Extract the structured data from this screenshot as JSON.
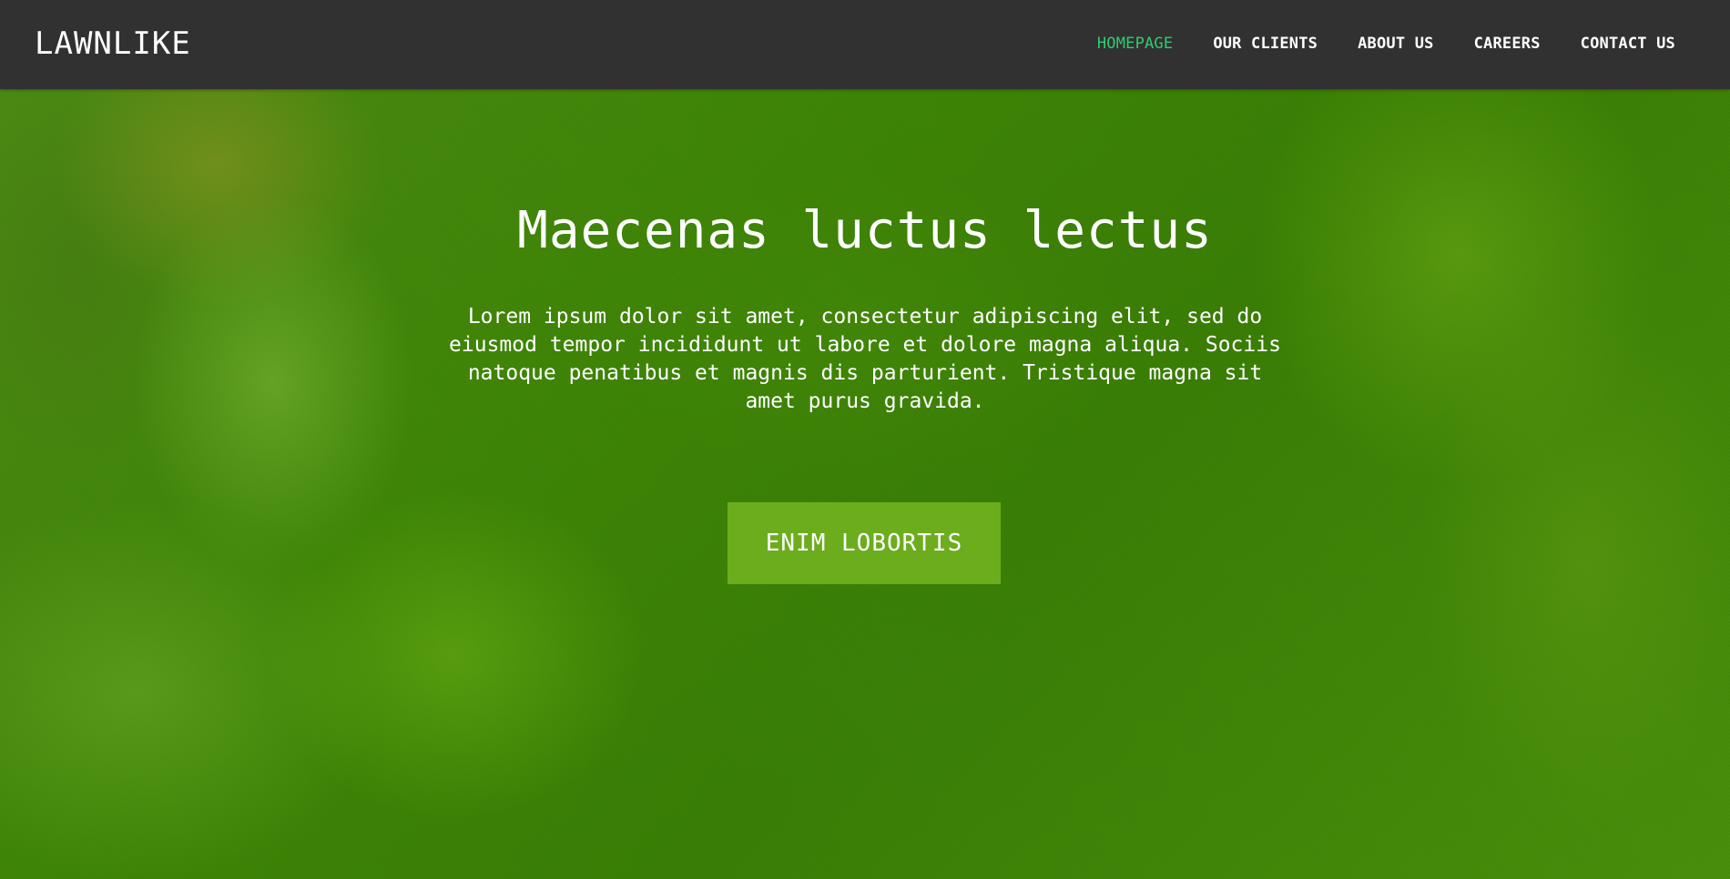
{
  "header": {
    "brand": "LAWNLIKE",
    "nav": [
      {
        "label": "HOMEPAGE",
        "active": true
      },
      {
        "label": "OUR CLIENTS",
        "active": false
      },
      {
        "label": "ABOUT US",
        "active": false
      },
      {
        "label": "CAREERS",
        "active": false
      },
      {
        "label": "CONTACT US",
        "active": false
      }
    ]
  },
  "hero": {
    "title": "Maecenas luctus lectus",
    "text": "Lorem ipsum dolor sit amet, consectetur adipiscing elit, sed do eiusmod tempor incididunt ut labore et dolore magna aliqua. Sociis natoque penatibus et magnis dis parturient. Tristique magna sit amet purus gravida.",
    "button_label": "ENIM LOBORTIS"
  },
  "colors": {
    "navbar": "#313131",
    "nav_active": "#2ecc71",
    "button": "#6cad1e",
    "hero_green": "#3f8507"
  }
}
